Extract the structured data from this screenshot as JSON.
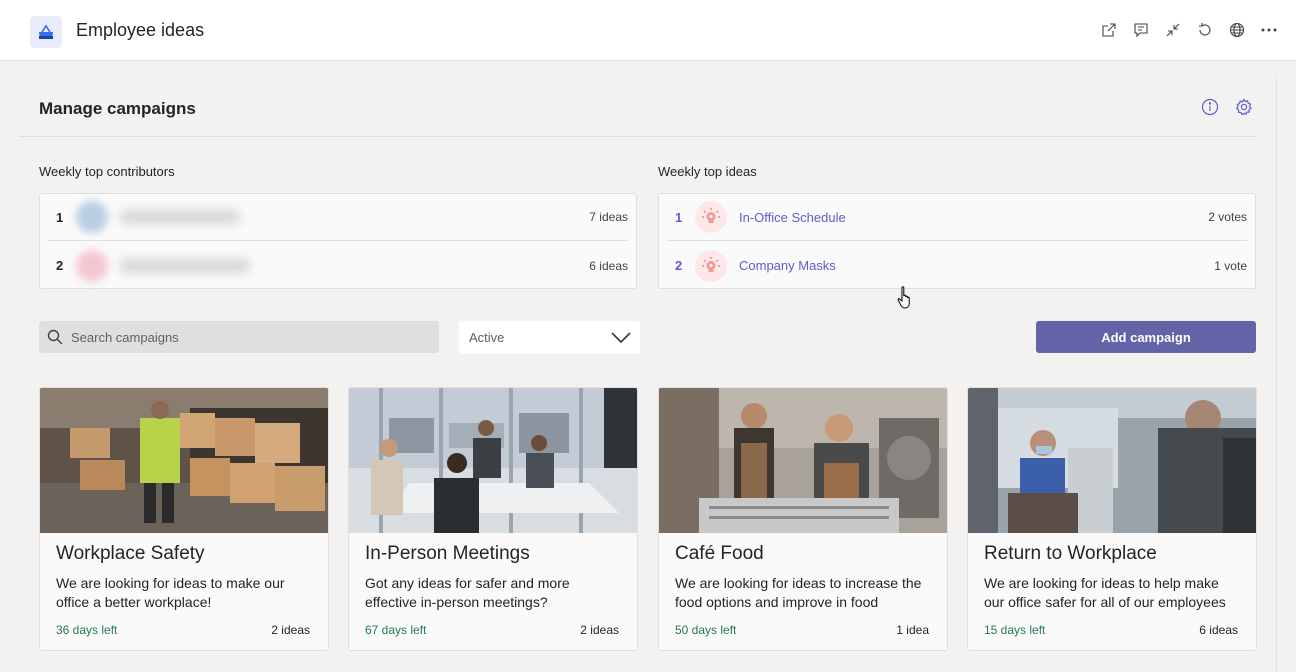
{
  "app": {
    "title": "Employee ideas"
  },
  "topbar": {
    "icons": [
      "popout-icon",
      "chat-icon",
      "collapse-icon",
      "refresh-icon",
      "globe-icon",
      "more-icon"
    ]
  },
  "page": {
    "title": "Manage campaigns"
  },
  "contributors": {
    "label": "Weekly top contributors",
    "items": [
      {
        "rank": "1",
        "count": "7 ideas"
      },
      {
        "rank": "2",
        "count": "6 ideas"
      }
    ]
  },
  "top_ideas": {
    "label": "Weekly top ideas",
    "items": [
      {
        "rank": "1",
        "title": "In-Office Schedule",
        "votes": "2 votes"
      },
      {
        "rank": "2",
        "title": "Company Masks",
        "votes": "1 vote"
      }
    ]
  },
  "search": {
    "placeholder": "Search campaigns"
  },
  "filter": {
    "selected": "Active"
  },
  "add_button": {
    "label": "Add campaign"
  },
  "campaigns": [
    {
      "title": "Workplace Safety",
      "description": "We are looking for ideas to make our office a better workplace!",
      "days_left": "36 days left",
      "ideas": "2 ideas"
    },
    {
      "title": "In-Person Meetings",
      "description": "Got any ideas for safer and more effective in-person meetings?",
      "days_left": "67 days left",
      "ideas": "2 ideas"
    },
    {
      "title": "Café Food",
      "description": "We are looking for ideas to increase the food options and improve in food",
      "days_left": "50 days left",
      "ideas": "1 idea"
    },
    {
      "title": "Return to Workplace",
      "description": "We are looking for ideas to help make our office safer for all of our employees",
      "days_left": "15 days left",
      "ideas": "6 ideas"
    }
  ],
  "colors": {
    "accent": "#6264a7",
    "link": "#5b5fc7",
    "days_left": "#237b4b",
    "background": "#f3f2f1"
  }
}
